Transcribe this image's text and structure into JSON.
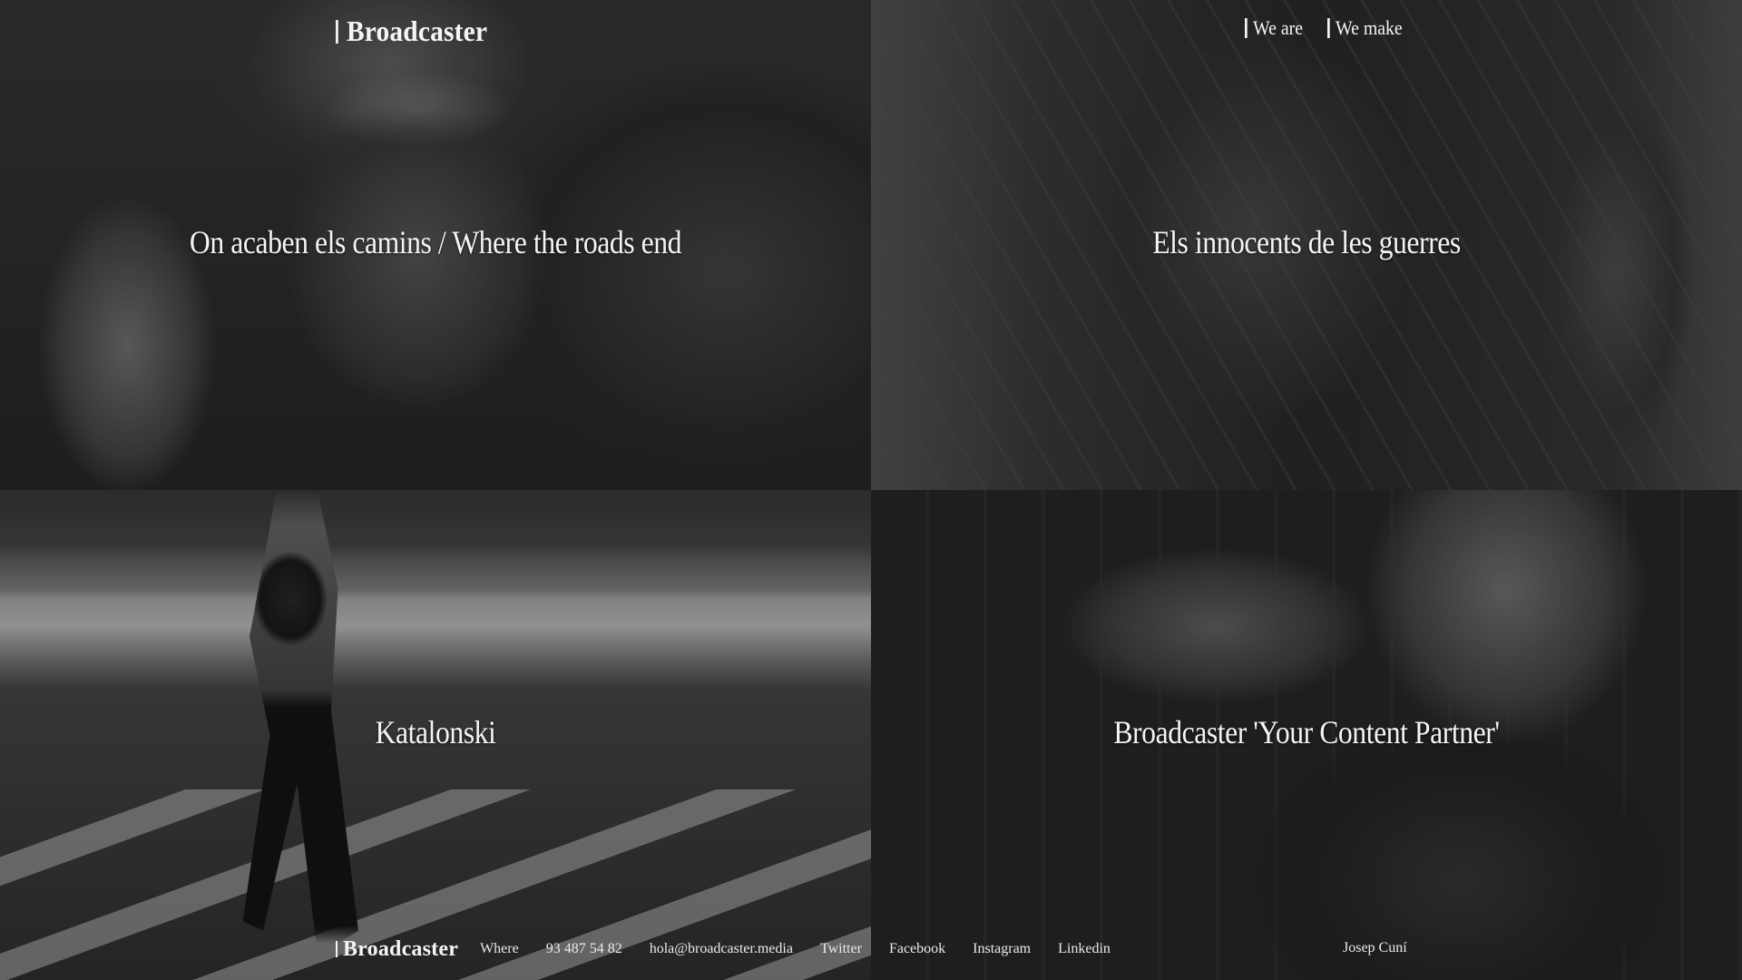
{
  "header": {
    "logo_text": "Broadcaster",
    "nav": [
      {
        "label": "We are"
      },
      {
        "label": "We make"
      }
    ]
  },
  "projects": [
    {
      "title": "On acaben els camins / Where the roads end"
    },
    {
      "title": "Els innocents de les guerres"
    },
    {
      "title": "Katalonski"
    },
    {
      "title": "Broadcaster 'Your Content Partner'"
    }
  ],
  "footer": {
    "logo_text": "Broadcaster",
    "where_label": "Where",
    "phone": "93 487 54 82",
    "email": "hola@broadcaster.media",
    "social": [
      "Twitter",
      "Facebook",
      "Instagram",
      "Linkedin"
    ],
    "credit": "Josep Cuní"
  }
}
